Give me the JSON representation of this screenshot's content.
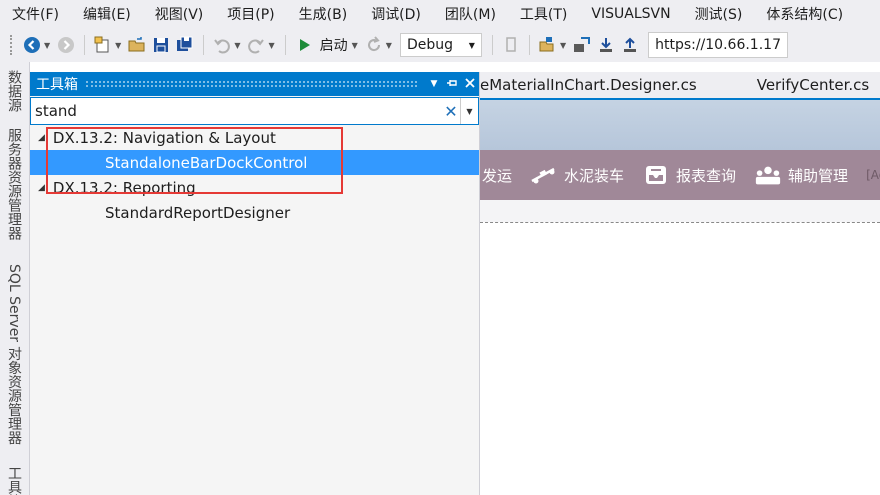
{
  "menubar": {
    "items": [
      "文件(F)",
      "编辑(E)",
      "视图(V)",
      "项目(P)",
      "生成(B)",
      "调试(D)",
      "团队(M)",
      "工具(T)",
      "VISUALSVN",
      "测试(S)",
      "体系结构(C)"
    ]
  },
  "toolbar": {
    "start_label": "启动",
    "config_value": "Debug",
    "url_value": "https://10.66.1.17"
  },
  "left_strip": {
    "tabs": [
      "数据源",
      "服务器资源管理器",
      "SQL Server 对象资源管理器",
      "工具箱"
    ]
  },
  "toolbox": {
    "title": "工具箱",
    "search_value": "stand",
    "tree": [
      {
        "type": "category",
        "label": "DX.13.2: Navigation & Layout"
      },
      {
        "type": "item",
        "label": "StandaloneBarDockControl",
        "selected": true
      },
      {
        "type": "category",
        "label": "DX.13.2: Reporting"
      },
      {
        "type": "item",
        "label": "StandardReportDesigner",
        "selected": false
      }
    ]
  },
  "editor": {
    "tabs": [
      "eMaterialInChart.Designer.cs",
      "VerifyCenter.cs"
    ],
    "purple_bar": {
      "first_label": "发运",
      "items": [
        {
          "label": "水泥装车",
          "icon": "conveyor-icon"
        },
        {
          "label": "报表查询",
          "icon": "inbox-tray-icon"
        },
        {
          "label": "辅助管理",
          "icon": "team-icon"
        }
      ],
      "end_text": "[Ad"
    }
  },
  "colors": {
    "accent": "#007acc",
    "selection": "#3399ff",
    "highlight_box": "#e53935",
    "purple_bar": "#a08898"
  }
}
